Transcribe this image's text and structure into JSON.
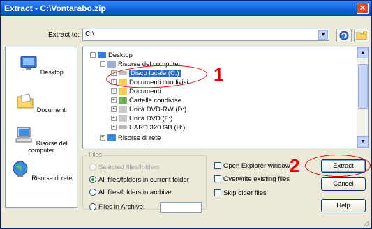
{
  "window": {
    "title": "Extract - C:\\Vontarabo.zip",
    "close_glyph": "✕"
  },
  "extract_to": {
    "label": "Extract to:",
    "value": "C:\\"
  },
  "places": [
    {
      "label": "Desktop",
      "icon": "desktop-icon"
    },
    {
      "label": "Documenti",
      "icon": "documents-icon"
    },
    {
      "label": "Risorse del computer",
      "icon": "my-computer-icon"
    },
    {
      "label": "Risorse di rete",
      "icon": "network-icon"
    }
  ],
  "tree": [
    {
      "label": "Desktop",
      "icon": "desktop-icon"
    },
    {
      "label": "Risorse del computer",
      "icon": "my-computer-icon"
    },
    {
      "label": "Disco locale (C:)",
      "icon": "drive-icon",
      "selected": true
    },
    {
      "label": "Documenti condivisi",
      "icon": "folder-icon"
    },
    {
      "label": "Documenti",
      "icon": "folder-icon"
    },
    {
      "label": "Cartelle condivise",
      "icon": "shared-folder-icon"
    },
    {
      "label": "Unità DVD-RW (D:)",
      "icon": "dvd-drive-icon"
    },
    {
      "label": "Unità DVD (F:)",
      "icon": "dvd-drive-icon"
    },
    {
      "label": "HARD 320 GB (H:)",
      "icon": "drive-icon"
    },
    {
      "label": "Risorse di rete",
      "icon": "network-icon"
    }
  ],
  "files": {
    "legend": "Files",
    "options": [
      {
        "label": "Selected files/folders",
        "checked": false,
        "disabled": true
      },
      {
        "label": "All files/folders in current folder",
        "checked": true,
        "disabled": false
      },
      {
        "label": "All files/folders in archive",
        "checked": false,
        "disabled": false
      },
      {
        "label": "Files in Archive:",
        "checked": false,
        "disabled": false
      }
    ],
    "archive_value": ""
  },
  "checkboxes": [
    {
      "label": "Open Explorer window",
      "checked": false
    },
    {
      "label": "Overwrite existing files",
      "checked": false
    },
    {
      "label": "Skip older files",
      "checked": false
    }
  ],
  "buttons": {
    "extract": "Extract",
    "cancel": "Cancel",
    "help": "Help"
  },
  "annotations": {
    "step1": "1",
    "step2": "2",
    "color": "#e00000"
  },
  "colors": {
    "title_bar": "#0a5fd8",
    "selection": "#316ac5",
    "dialog_bg": "#ece9d8"
  }
}
